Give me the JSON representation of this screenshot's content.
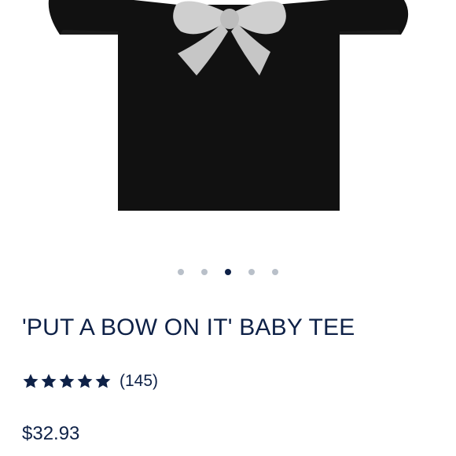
{
  "carousel": {
    "count": 5,
    "active_index": 2
  },
  "product": {
    "title": "'PUT A BOW ON IT' BABY TEE",
    "rating": 5,
    "rating_max": 5,
    "review_count": "(145)",
    "price": "$32.93"
  },
  "colors": {
    "text": "#0e2147",
    "dot_inactive": "#b9c0c9",
    "dot_active": "#0e2147",
    "shirt": "#111111",
    "bow": "#cfcfcf"
  },
  "icons": {
    "rating_star": "star-icon"
  }
}
